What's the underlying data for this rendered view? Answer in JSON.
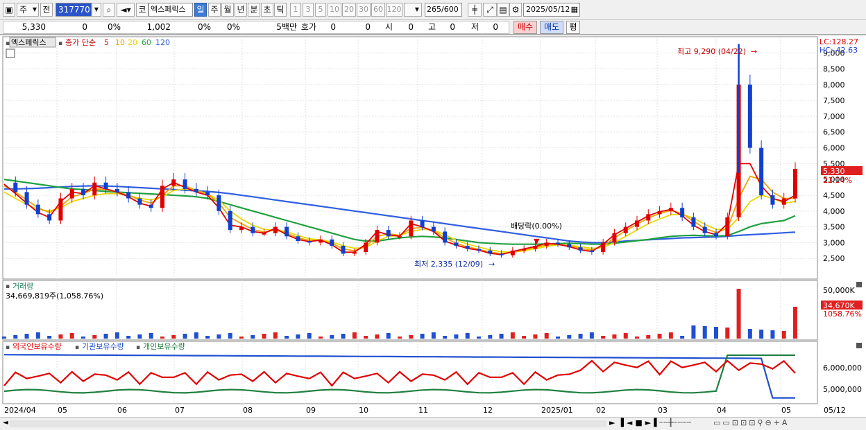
{
  "toolbar": {
    "period_type": "주",
    "prev_label": "전",
    "stock_code": "317770",
    "market_label": "코",
    "stock_name": "엑스페릭스",
    "periods": [
      "일",
      "주",
      "월",
      "년",
      "분",
      "초",
      "틱"
    ],
    "selected_period": "일",
    "minute_options": [
      "1",
      "3",
      "5",
      "10",
      "20",
      "30",
      "60",
      "120"
    ],
    "count_current": "265",
    "count_total": "/600",
    "date": "2025/05/12"
  },
  "quote": {
    "price": "5,330",
    "change": "0",
    "change_pct": "0%",
    "volume": "1,002",
    "vol_pct1": "0%",
    "vol_pct2": "0%",
    "unit_label": "5백만",
    "hoga_label": "호가",
    "hoga_val1": "0",
    "hoga_val2": "0",
    "open_label": "시",
    "open_val": "0",
    "high_label": "고",
    "high_val": "0",
    "low_label": "저",
    "low_val": "0",
    "buy_label": "매수",
    "sell_label": "매도",
    "eval_label": "평"
  },
  "price_panel": {
    "stock_tag": "엑스페릭스",
    "legend_prefix": "종가 단순",
    "ma_labels": [
      "5",
      "10",
      "20",
      "60",
      "120"
    ],
    "ma_colors": [
      "#e00000",
      "#f0a000",
      "#e8d800",
      "#20a040",
      "#3060e0"
    ],
    "lc_label": "LC:128.27",
    "hc_label": "HC:-42.63",
    "high_annotation": "최고 9,290 (04/22)",
    "low_annotation": "최저 2,335 (12/09)",
    "dividend_annotation": "배당락(0.00%)",
    "current_price_tag": "5,330",
    "current_pct_tag": "21.14%"
  },
  "volume_panel": {
    "title": "거래량",
    "value_label": "34,669,819주(1,058.76%)",
    "axis_label": "50,000K",
    "current_tag": "34,670K",
    "current_pct_tag": "1058.76%"
  },
  "holding_panel": {
    "legend": [
      "외국인보유수량",
      "기관보유수량",
      "개인보유수량"
    ],
    "legend_colors": [
      "#e00000",
      "#2050d0",
      "#208040"
    ],
    "axis_labels": [
      "6,000,000",
      "5,000,000"
    ]
  },
  "x_axis": {
    "labels": [
      "2024/04",
      "05",
      "06",
      "07",
      "08",
      "09",
      "10",
      "11",
      "12",
      "2025/01",
      "02",
      "03",
      "04",
      "05"
    ],
    "end_label": "05/12"
  },
  "chart_data": {
    "type": "candlestick",
    "title": "엑스페릭스",
    "y_ticks": [
      2500,
      3000,
      3500,
      4000,
      4500,
      5000,
      5500,
      6000,
      6500,
      7000,
      7500,
      8000,
      8500,
      9000
    ],
    "ylim": [
      2000,
      9300
    ],
    "high": {
      "value": 9290,
      "date": "04/22"
    },
    "low": {
      "value": 2335,
      "date": "12/09"
    },
    "last_close": 5330,
    "close_series": [
      4900,
      4600,
      4200,
      3900,
      3700,
      4400,
      4700,
      4500,
      4900,
      4700,
      4600,
      4400,
      4200,
      4100,
      4800,
      5000,
      4700,
      4600,
      4500,
      4000,
      3400,
      3500,
      3300,
      3300,
      3500,
      3200,
      3050,
      3000,
      3100,
      2900,
      2650,
      2700,
      3000,
      3400,
      3200,
      3200,
      3700,
      3500,
      3350,
      3000,
      2900,
      2800,
      2750,
      2650,
      2600,
      2750,
      2800,
      2900,
      3000,
      2950,
      2850,
      2750,
      2700,
      3000,
      3300,
      3500,
      3700,
      3900,
      4000,
      4100,
      3800,
      3500,
      3300,
      3200,
      3800,
      8000,
      6000,
      4500,
      4200,
      4400,
      5330
    ],
    "ma_series": [
      {
        "name": "5",
        "values": [
          4850,
          4550,
          4250,
          3950,
          3800,
          4300,
          4600,
          4550,
          4800,
          4700,
          4600,
          4450,
          4250,
          4150,
          4700,
          4900,
          4750,
          4600,
          4500,
          4100,
          3550,
          3500,
          3350,
          3300,
          3450,
          3250,
          3100,
          3030,
          3080,
          2930,
          2700,
          2700,
          2950,
          3350,
          3250,
          3200,
          3600,
          3500,
          3350,
          3050,
          2920,
          2820,
          2760,
          2660,
          2620,
          2720,
          2800,
          2880,
          2980,
          2950,
          2870,
          2770,
          2720,
          2950,
          3250,
          3450,
          3650,
          3850,
          3980,
          4050,
          3850,
          3550,
          3350,
          3250,
          3600,
          5500,
          5500,
          4800,
          4400,
          4300,
          4500
        ]
      },
      {
        "name": "10",
        "values": [
          4800,
          4600,
          4350,
          4100,
          3950,
          4150,
          4450,
          4550,
          4700,
          4680,
          4600,
          4500,
          4350,
          4250,
          4500,
          4800,
          4800,
          4650,
          4550,
          4250,
          3800,
          3600,
          3420,
          3330,
          3400,
          3300,
          3150,
          3070,
          3070,
          2980,
          2800,
          2740,
          2880,
          3200,
          3280,
          3230,
          3450,
          3480,
          3380,
          3150,
          2980,
          2860,
          2790,
          2700,
          2650,
          2690,
          2770,
          2850,
          2930,
          2950,
          2900,
          2820,
          2760,
          2880,
          3150,
          3380,
          3580,
          3780,
          3920,
          4020,
          3920,
          3680,
          3450,
          3320,
          3450,
          4400,
          5100,
          5000,
          4600,
          4400,
          4400
        ]
      },
      {
        "name": "20",
        "values": [
          4600,
          4400,
          4200,
          4050,
          4000,
          4100,
          4300,
          4400,
          4500,
          4550,
          4550,
          4500,
          4400,
          4350,
          4450,
          4650,
          4700,
          4650,
          4550,
          4350,
          4000,
          3750,
          3550,
          3420,
          3400,
          3350,
          3220,
          3120,
          3090,
          3020,
          2900,
          2820,
          2850,
          3050,
          3200,
          3230,
          3350,
          3420,
          3400,
          3250,
          3080,
          2950,
          2860,
          2770,
          2710,
          2700,
          2740,
          2810,
          2880,
          2930,
          2920,
          2870,
          2820,
          2850,
          3000,
          3200,
          3400,
          3600,
          3750,
          3880,
          3900,
          3780,
          3580,
          3420,
          3420,
          3800,
          4300,
          4500,
          4400,
          4250,
          4300
        ]
      },
      {
        "name": "60",
        "values": [
          5000,
          4950,
          4900,
          4850,
          4800,
          4750,
          4700,
          4680,
          4650,
          4620,
          4600,
          4580,
          4560,
          4540,
          4520,
          4500,
          4480,
          4450,
          4400,
          4300,
          4200,
          4100,
          4000,
          3900,
          3800,
          3700,
          3600,
          3500,
          3400,
          3300,
          3200,
          3100,
          3050,
          3050,
          3100,
          3150,
          3180,
          3200,
          3180,
          3150,
          3100,
          3050,
          3000,
          2980,
          2960,
          2950,
          2950,
          2950,
          2960,
          2970,
          2980,
          2970,
          2950,
          2950,
          2980,
          3020,
          3060,
          3100,
          3150,
          3200,
          3220,
          3230,
          3220,
          3210,
          3220,
          3350,
          3500,
          3600,
          3650,
          3700,
          3850
        ]
      },
      {
        "name": "120",
        "values": [
          4700,
          4700,
          4710,
          4720,
          4740,
          4760,
          4780,
          4790,
          4800,
          4790,
          4780,
          4760,
          4740,
          4720,
          4700,
          4680,
          4660,
          4640,
          4620,
          4590,
          4550,
          4500,
          4450,
          4400,
          4350,
          4300,
          4250,
          4200,
          4150,
          4100,
          4050,
          4000,
          3950,
          3900,
          3850,
          3800,
          3750,
          3700,
          3650,
          3600,
          3550,
          3500,
          3450,
          3400,
          3350,
          3300,
          3250,
          3200,
          3150,
          3100,
          3050,
          3020,
          3000,
          3000,
          3020,
          3050,
          3070,
          3090,
          3110,
          3130,
          3150,
          3160,
          3170,
          3180,
          3200,
          3230,
          3250,
          3270,
          3290,
          3310,
          3330
        ]
      }
    ]
  }
}
